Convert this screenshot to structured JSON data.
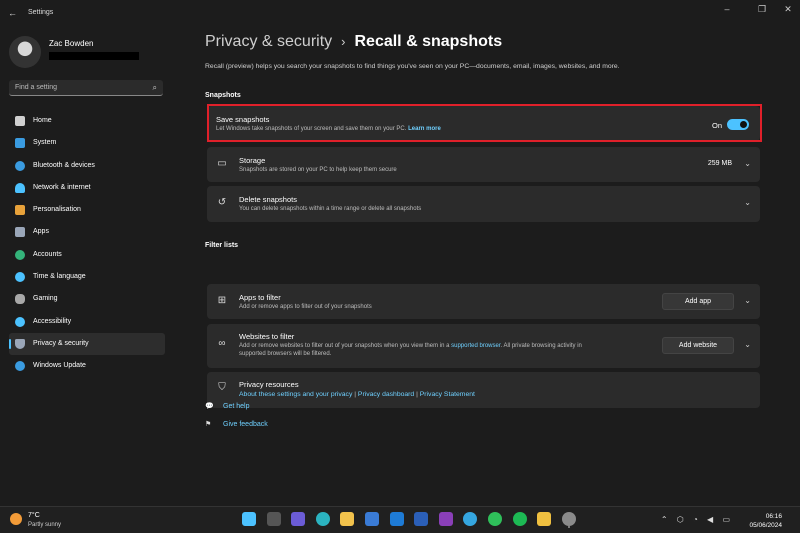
{
  "window": {
    "title": "Settings",
    "back_icon": "back-arrow-icon"
  },
  "profile": {
    "name": "Zac Bowden"
  },
  "search": {
    "placeholder": "Find a setting"
  },
  "sidebar": {
    "items": [
      {
        "label": "Home",
        "icon": "home-icon",
        "color": "#d0d0d0"
      },
      {
        "label": "System",
        "icon": "system-icon",
        "color": "#3a9be0"
      },
      {
        "label": "Bluetooth & devices",
        "icon": "bluetooth-icon",
        "color": "#3a9be0"
      },
      {
        "label": "Network & internet",
        "icon": "wifi-icon",
        "color": "#4cc2ff"
      },
      {
        "label": "Personalisation",
        "icon": "brush-icon",
        "color": "#e8a23a"
      },
      {
        "label": "Apps",
        "icon": "apps-icon",
        "color": "#9aa6b8"
      },
      {
        "label": "Accounts",
        "icon": "accounts-icon",
        "color": "#34b37a"
      },
      {
        "label": "Time & language",
        "icon": "globe-icon",
        "color": "#4cc2ff"
      },
      {
        "label": "Gaming",
        "icon": "controller-icon",
        "color": "#a8a8a8"
      },
      {
        "label": "Accessibility",
        "icon": "accessibility-icon",
        "color": "#4cc2ff"
      },
      {
        "label": "Privacy & security",
        "icon": "shield-icon",
        "color": "#9aa6b8",
        "active": true
      },
      {
        "label": "Windows Update",
        "icon": "update-icon",
        "color": "#3a9be0"
      }
    ]
  },
  "breadcrumb": {
    "parent": "Privacy & security",
    "separator": "›",
    "current": "Recall & snapshots"
  },
  "description": "Recall (preview) helps you search your snapshots to find things you've seen on your PC—documents, email, images, websites, and more.",
  "snapshots": {
    "heading": "Snapshots",
    "save": {
      "title": "Save snapshots",
      "subtitle": "Let Windows take snapshots of your screen and save them on your PC.",
      "learn_more": "Learn more",
      "state_label": "On",
      "enabled": true
    },
    "storage": {
      "title": "Storage",
      "subtitle": "Snapshots are stored on your PC to help keep them secure",
      "value": "259 MB"
    },
    "delete": {
      "title": "Delete snapshots",
      "subtitle": "You can delete snapshots within a time range or delete all snapshots"
    }
  },
  "filters": {
    "heading": "Filter lists",
    "apps": {
      "title": "Apps to filter",
      "subtitle": "Add or remove apps to filter out of your snapshots",
      "button": "Add app"
    },
    "websites": {
      "title": "Websites to filter",
      "subtitle_1": "Add or remove websites to filter out of your snapshots when you view them in a",
      "subtitle_link": "supported browser",
      "subtitle_2": ". All private browsing activity in",
      "subtitle_3": "supported browsers will be filtered.",
      "button": "Add website"
    },
    "resources": {
      "title": "Privacy resources",
      "link_1": "About these settings and your privacy",
      "sep": "|",
      "link_2": "Privacy dashboard",
      "link_3": "Privacy Statement"
    }
  },
  "help": {
    "get_help": "Get help",
    "feedback": "Give feedback"
  },
  "taskbar": {
    "weather": {
      "temp": "7°C",
      "condition": "Partly sunny"
    },
    "apps": [
      {
        "icon": "windows-start-icon",
        "color": "#4cc2ff"
      },
      {
        "icon": "search-icon",
        "color": "#555555"
      },
      {
        "icon": "file-explorer-icon",
        "color": "#6b5cd6"
      },
      {
        "icon": "edge-icon",
        "color": "#2bb3c0"
      },
      {
        "icon": "folder-icon",
        "color": "#f2c24c"
      },
      {
        "icon": "store-icon",
        "color": "#3a7bd5"
      },
      {
        "icon": "outlook-icon",
        "color": "#1e7bd6"
      },
      {
        "icon": "word-icon",
        "color": "#2b5fb8"
      },
      {
        "icon": "onenote-icon",
        "color": "#8a3fb8"
      },
      {
        "icon": "telegram-icon",
        "color": "#35a6e0"
      },
      {
        "icon": "whatsapp-icon",
        "color": "#2fbf5a"
      },
      {
        "icon": "spotify-icon",
        "color": "#1db954"
      },
      {
        "icon": "photos-icon",
        "color": "#f0c040"
      },
      {
        "icon": "settings-icon",
        "color": "#8a8a8a",
        "active": true
      }
    ],
    "tray_icons": [
      "chevron-up-icon",
      "network-icon",
      "wifi-icon",
      "volume-icon",
      "battery-icon"
    ],
    "time": "06:16",
    "date": "05/06/2024"
  }
}
